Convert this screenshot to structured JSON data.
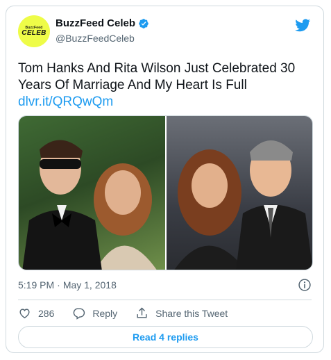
{
  "author": {
    "name": "BuzzFeed Celeb",
    "handle": "@BuzzFeedCeleb",
    "avatar_text_top": "BuzzFeed",
    "avatar_text_main": "CELEB",
    "avatar_color": "#eefc48",
    "verified": true
  },
  "tweet": {
    "text": "Tom Hanks And Rita Wilson Just Celebrated 30 Years Of Marriage And My Heart Is Full",
    "link": "dlvr.it/QRQwQm",
    "time": "5:19 PM",
    "separator": "·",
    "date": "May 1, 2018"
  },
  "actions": {
    "like_count": "286",
    "reply_label": "Reply",
    "share_label": "Share this Tweet"
  },
  "read_replies_label": "Read 4 replies",
  "icons": {
    "brand": "twitter-bird-icon",
    "verified": "verified-badge-icon",
    "info": "info-icon",
    "like": "heart-icon",
    "reply": "reply-icon",
    "share": "share-icon"
  },
  "colors": {
    "accent": "#1d9bf0",
    "text": "#0f1419",
    "secondary": "#536471",
    "border": "#cfd9de"
  }
}
